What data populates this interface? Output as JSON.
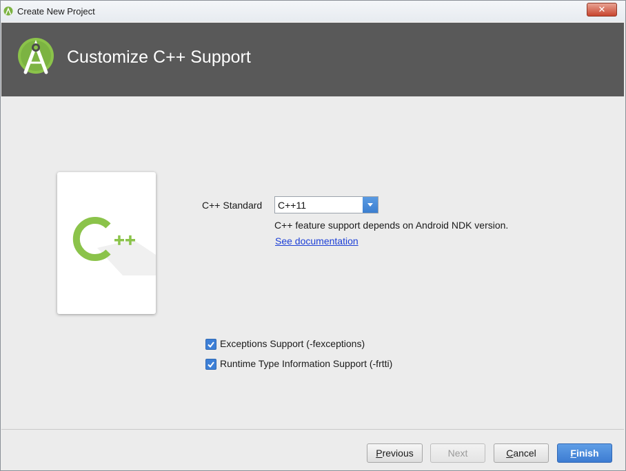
{
  "window": {
    "title": "Create New Project",
    "close_glyph": "✕",
    "icons": {
      "app": "android-studio-icon",
      "close": "close-icon"
    }
  },
  "header": {
    "title": "Customize C++ Support",
    "logo_icon": "android-studio-logo-icon"
  },
  "preview": {
    "icon": "cpp-logo-icon",
    "glyph_c": "C",
    "glyph_pp": "++"
  },
  "form": {
    "cpp_standard_label": "C++ Standard",
    "cpp_standard_value": "C++11",
    "note": "C++ feature support depends on Android NDK version.",
    "doc_link": "See documentation",
    "options": [
      {
        "label": "Exceptions Support (-fexceptions)",
        "checked": true
      },
      {
        "label": "Runtime Type Information Support (-frtti)",
        "checked": true
      }
    ]
  },
  "buttons": {
    "previous": "Previous",
    "next": "Next",
    "cancel": "Cancel",
    "finish": "Finish"
  },
  "colors": {
    "header_bg": "#595959",
    "accent_blue": "#3d7fd6",
    "cpp_green": "#8bc34a",
    "link": "#1c3fd6"
  }
}
